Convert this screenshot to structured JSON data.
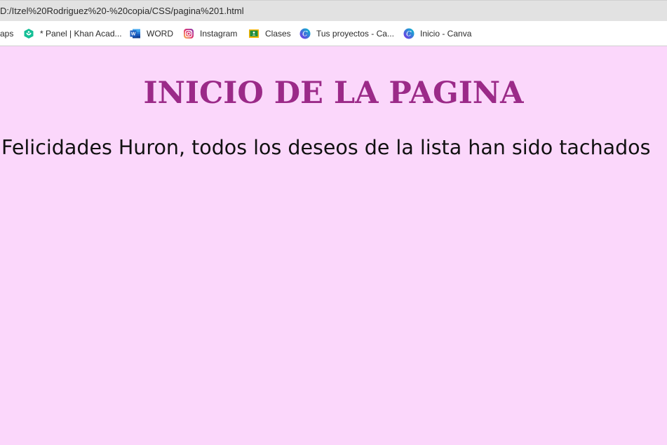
{
  "browser": {
    "address": "D:/Itzel%20Rodriguez%20-%20copia/CSS/pagina%201.html",
    "bookmarks": [
      {
        "label": "aps",
        "icon": "apps-icon"
      },
      {
        "label": "* Panel | Khan Acad...",
        "icon": "khan-academy-icon",
        "color": "#14bf96"
      },
      {
        "label": "WORD",
        "icon": "word-icon",
        "color": "#2b579a"
      },
      {
        "label": "Instagram",
        "icon": "instagram-icon",
        "color": "#d6249f"
      },
      {
        "label": "Clases",
        "icon": "classroom-icon",
        "color": "#f4b400"
      },
      {
        "label": "Tus proyectos - Ca...",
        "icon": "canva-icon",
        "color": "#7d2ae8"
      },
      {
        "label": "Inicio - Canva",
        "icon": "canva-icon",
        "color": "#7d2ae8"
      }
    ]
  },
  "page": {
    "title": "INICIO DE LA PAGINA",
    "text": "Felicidades Huron, todos los deseos de la lista han sido tachados",
    "background_color": "#fbd7fb",
    "title_color": "#9b2a88"
  }
}
